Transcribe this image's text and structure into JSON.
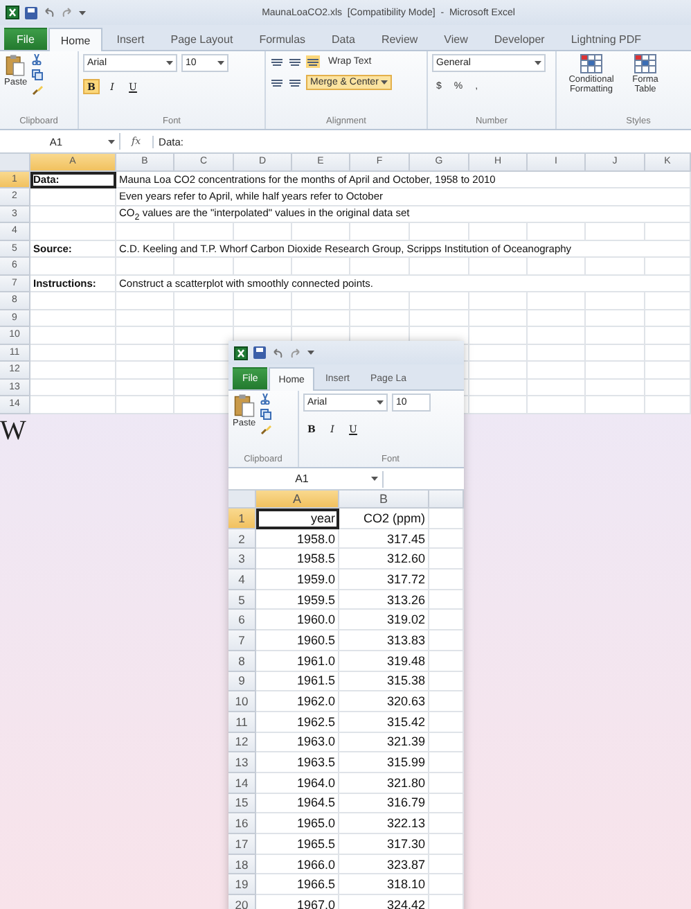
{
  "slide": {
    "letter": "W"
  },
  "main_window": {
    "title": "MaunaLoaCO2.xls  [Compatibility Mode]  -  Microsoft Excel",
    "tabs": [
      {
        "label": "File",
        "kind": "file",
        "selected": false
      },
      {
        "label": "Home",
        "kind": "tab",
        "selected": true
      },
      {
        "label": "Insert",
        "kind": "tab",
        "selected": false
      },
      {
        "label": "Page Layout",
        "kind": "tab",
        "selected": false
      },
      {
        "label": "Formulas",
        "kind": "tab",
        "selected": false
      },
      {
        "label": "Data",
        "kind": "tab",
        "selected": false
      },
      {
        "label": "Review",
        "kind": "tab",
        "selected": false
      },
      {
        "label": "View",
        "kind": "tab",
        "selected": false
      },
      {
        "label": "Developer",
        "kind": "tab",
        "selected": false
      },
      {
        "label": "Lightning PDF",
        "kind": "tab",
        "selected": false
      }
    ],
    "ribbon": {
      "paste": "Paste",
      "clipboard_group": "Clipboard",
      "font_name": "Arial",
      "font_size": "10",
      "styles": [
        {
          "label": "B",
          "on": true
        },
        {
          "label": "I",
          "on": false
        },
        {
          "label": "U",
          "on": false
        }
      ],
      "font_group": "Font",
      "wrap": "Wrap Text",
      "merge": {
        "label": "Merge & Center",
        "on": true
      },
      "alignment_group": "Alignment",
      "number_format": "General",
      "number_symbols": [
        "$",
        "%",
        ","
      ],
      "number_group": "Number",
      "style_buttons": [
        "Conditional Formatting",
        "Forma Table"
      ],
      "styles_group": "Styles"
    },
    "name_box": "A1",
    "fx": "fx",
    "formula": "Data:",
    "columns": [
      {
        "label": "A",
        "selected": true
      },
      {
        "label": "B",
        "selected": false
      },
      {
        "label": "C",
        "selected": false
      },
      {
        "label": "D",
        "selected": false
      },
      {
        "label": "E",
        "selected": false
      },
      {
        "label": "F",
        "selected": false
      },
      {
        "label": "G",
        "selected": false
      },
      {
        "label": "H",
        "selected": false
      },
      {
        "label": "I",
        "selected": false
      },
      {
        "label": "J",
        "selected": false
      },
      {
        "label": "K",
        "selected": false
      }
    ],
    "rows": [
      {
        "header": "1",
        "selected": true,
        "a": "Data:",
        "b": "Mauna Loa CO2 concentrations for the months of April and October, 1958 to 2010"
      },
      {
        "header": "2",
        "selected": false,
        "b": "Even years refer to April, while half years refer to October"
      },
      {
        "header": "3",
        "selected": false,
        "b": "CO$_{2}$ values  are the \"interpolated\" values in the original data set"
      },
      {
        "header": "4",
        "selected": false
      },
      {
        "header": "5",
        "selected": false,
        "a": "Source:",
        "b": "C.D. Keeling and T.P. Whorf   Carbon Dioxide Research Group, Scripps Institution of Oceanography"
      },
      {
        "header": "6",
        "selected": false
      },
      {
        "header": "7",
        "selected": false,
        "a": "Instructions:",
        "b": "Construct a scatterplot with smoothly connected points."
      },
      {
        "header": "8",
        "selected": false
      },
      {
        "header": "9",
        "selected": false
      },
      {
        "header": "10",
        "selected": false
      },
      {
        "header": "11",
        "selected": false
      },
      {
        "header": "12",
        "selected": false
      },
      {
        "header": "13",
        "selected": false
      },
      {
        "header": "14",
        "selected": false
      }
    ]
  },
  "inset_window": {
    "tabs": [
      {
        "label": "File",
        "kind": "file",
        "selected": false
      },
      {
        "label": "Home",
        "kind": "tab",
        "selected": true
      },
      {
        "label": "Insert",
        "kind": "tab",
        "selected": false
      },
      {
        "label": "Page La",
        "kind": "tab",
        "selected": false
      }
    ],
    "paste": "Paste",
    "clipboard_group": "Clipboard",
    "font_name": "Arial",
    "font_size": "10",
    "styles": [
      {
        "label": "B",
        "on": false
      },
      {
        "label": "I",
        "on": false
      },
      {
        "label": "U",
        "on": false
      }
    ],
    "font_group": "Font",
    "name_box": "A1",
    "columns": [
      {
        "label": "A",
        "selected": true
      },
      {
        "label": "B",
        "selected": false
      }
    ],
    "rows": [
      {
        "header": "1",
        "selected": true,
        "a": "year",
        "b": "CO2 (ppm)"
      },
      {
        "header": "2",
        "selected": false,
        "a": "1958.0",
        "b": "317.45"
      },
      {
        "header": "3",
        "selected": false,
        "a": "1958.5",
        "b": "312.60"
      },
      {
        "header": "4",
        "selected": false,
        "a": "1959.0",
        "b": "317.72"
      },
      {
        "header": "5",
        "selected": false,
        "a": "1959.5",
        "b": "313.26"
      },
      {
        "header": "6",
        "selected": false,
        "a": "1960.0",
        "b": "319.02"
      },
      {
        "header": "7",
        "selected": false,
        "a": "1960.5",
        "b": "313.83"
      },
      {
        "header": "8",
        "selected": false,
        "a": "1961.0",
        "b": "319.48"
      },
      {
        "header": "9",
        "selected": false,
        "a": "1961.5",
        "b": "315.38"
      },
      {
        "header": "10",
        "selected": false,
        "a": "1962.0",
        "b": "320.63"
      },
      {
        "header": "11",
        "selected": false,
        "a": "1962.5",
        "b": "315.42"
      },
      {
        "header": "12",
        "selected": false,
        "a": "1963.0",
        "b": "321.39"
      },
      {
        "header": "13",
        "selected": false,
        "a": "1963.5",
        "b": "315.99"
      },
      {
        "header": "14",
        "selected": false,
        "a": "1964.0",
        "b": "321.80"
      },
      {
        "header": "15",
        "selected": false,
        "a": "1964.5",
        "b": "316.79"
      },
      {
        "header": "16",
        "selected": false,
        "a": "1965.0",
        "b": "322.13"
      },
      {
        "header": "17",
        "selected": false,
        "a": "1965.5",
        "b": "317.30"
      },
      {
        "header": "18",
        "selected": false,
        "a": "1966.0",
        "b": "323.87"
      },
      {
        "header": "19",
        "selected": false,
        "a": "1966.5",
        "b": "318.10"
      },
      {
        "header": "20",
        "selected": false,
        "a": "1967.0",
        "b": "324.42"
      }
    ]
  }
}
